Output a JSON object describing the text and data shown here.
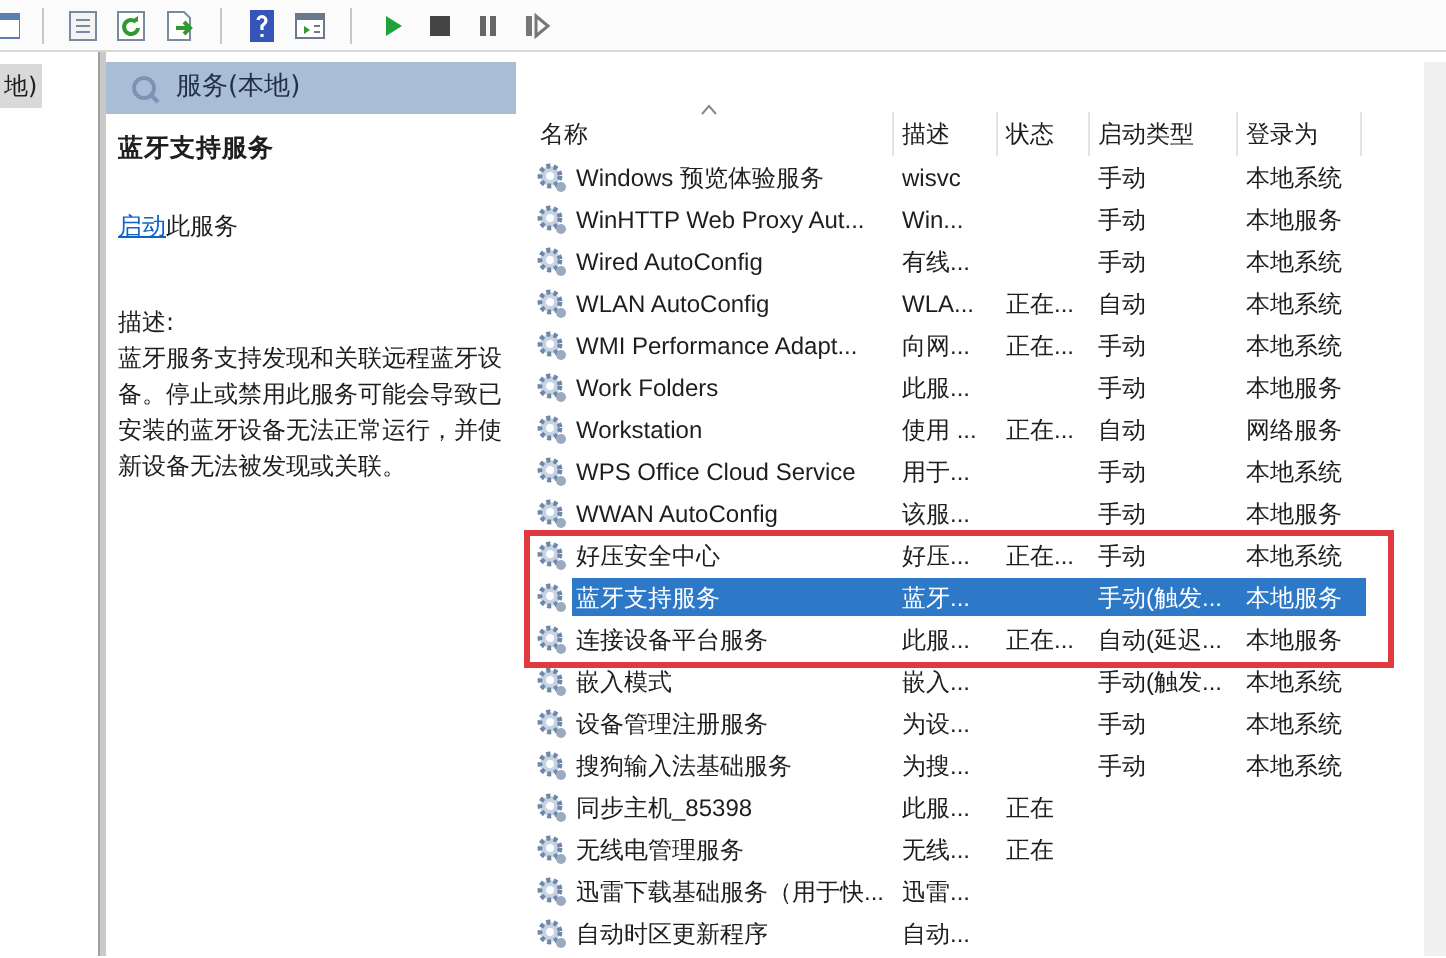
{
  "tree": {
    "items": [
      {
        "label": "地)",
        "selected": true
      }
    ]
  },
  "panel": {
    "title": "服务(本地)"
  },
  "details": {
    "service_name": "蓝牙支持服务",
    "action_link": "启动",
    "action_suffix": "此服务",
    "description_label": "描述:",
    "description": "蓝牙服务支持发现和关联远程蓝牙设备。停止或禁用此服务可能会导致已安装的蓝牙设备无法正常运行，并使新设备无法被发现或关联。"
  },
  "table": {
    "columns": [
      {
        "label": "名称",
        "sorted": true
      },
      {
        "label": "描述",
        "sorted": false
      },
      {
        "label": "状态",
        "sorted": false
      },
      {
        "label": "启动类型",
        "sorted": false
      },
      {
        "label": "登录为",
        "sorted": false
      }
    ],
    "rows": [
      {
        "name": "Windows 预览体验服务",
        "description": "wisvc",
        "status": "",
        "startup": "手动",
        "logon": "本地系统",
        "selected": false,
        "boxed": false
      },
      {
        "name": "WinHTTP Web Proxy Aut...",
        "description": "Win...",
        "status": "",
        "startup": "手动",
        "logon": "本地服务",
        "selected": false,
        "boxed": false
      },
      {
        "name": "Wired AutoConfig",
        "description": "有线...",
        "status": "",
        "startup": "手动",
        "logon": "本地系统",
        "selected": false,
        "boxed": false
      },
      {
        "name": "WLAN AutoConfig",
        "description": "WLA...",
        "status": "正在...",
        "startup": "自动",
        "logon": "本地系统",
        "selected": false,
        "boxed": false
      },
      {
        "name": "WMI Performance Adapt...",
        "description": "向网...",
        "status": "正在...",
        "startup": "手动",
        "logon": "本地系统",
        "selected": false,
        "boxed": false
      },
      {
        "name": "Work Folders",
        "description": "此服...",
        "status": "",
        "startup": "手动",
        "logon": "本地服务",
        "selected": false,
        "boxed": false
      },
      {
        "name": "Workstation",
        "description": "使用 ...",
        "status": "正在...",
        "startup": "自动",
        "logon": "网络服务",
        "selected": false,
        "boxed": false
      },
      {
        "name": "WPS Office Cloud Service",
        "description": "用于...",
        "status": "",
        "startup": "手动",
        "logon": "本地系统",
        "selected": false,
        "boxed": false
      },
      {
        "name": "WWAN AutoConfig",
        "description": "该服...",
        "status": "",
        "startup": "手动",
        "logon": "本地服务",
        "selected": false,
        "boxed": false
      },
      {
        "name": "好压安全中心",
        "description": "好压...",
        "status": "正在...",
        "startup": "手动",
        "logon": "本地系统",
        "selected": false,
        "boxed": true
      },
      {
        "name": "蓝牙支持服务",
        "description": "蓝牙...",
        "status": "",
        "startup": "手动(触发...",
        "logon": "本地服务",
        "selected": true,
        "boxed": true
      },
      {
        "name": "连接设备平台服务",
        "description": "此服...",
        "status": "正在...",
        "startup": "自动(延迟...",
        "logon": "本地服务",
        "selected": false,
        "boxed": true
      },
      {
        "name": "嵌入模式",
        "description": "嵌入...",
        "status": "",
        "startup": "手动(触发...",
        "logon": "本地系统",
        "selected": false,
        "boxed": false
      },
      {
        "name": "设备管理注册服务",
        "description": "为设...",
        "status": "",
        "startup": "手动",
        "logon": "本地系统",
        "selected": false,
        "boxed": false
      },
      {
        "name": "搜狗输入法基础服务",
        "description": "为搜...",
        "status": "",
        "startup": "手动",
        "logon": "本地系统",
        "selected": false,
        "boxed": false
      },
      {
        "name": "同步主机_85398",
        "description": "此服...",
        "status": "正在",
        "startup": "",
        "logon": "",
        "selected": false,
        "boxed": false
      },
      {
        "name": "无线电管理服务",
        "description": "无线...",
        "status": "正在",
        "startup": "",
        "logon": "",
        "selected": false,
        "boxed": false
      },
      {
        "name": "迅雷下载基础服务（用于快...",
        "description": "迅雷...",
        "status": "",
        "startup": "",
        "logon": "",
        "selected": false,
        "boxed": false
      },
      {
        "name": "自动时区更新程序",
        "description": "自动...",
        "status": "",
        "startup": "",
        "logon": "",
        "selected": false,
        "boxed": false
      }
    ]
  }
}
